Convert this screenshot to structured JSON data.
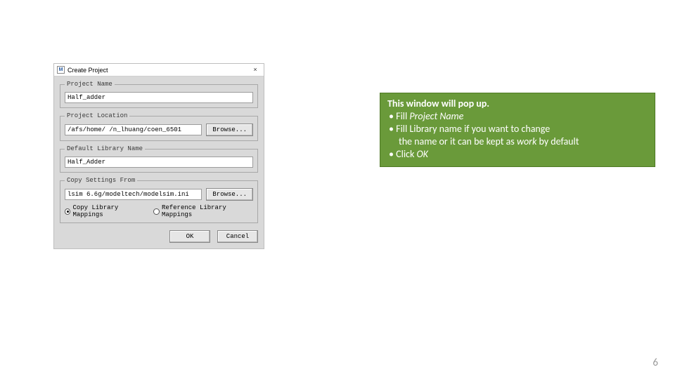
{
  "dialog": {
    "app_icon_letter": "M",
    "title": "Create Project",
    "close_glyph": "×",
    "group_project_name": {
      "legend": "Project Name",
      "value": "Half_adder"
    },
    "group_project_location": {
      "legend": "Project Location",
      "value": "/afs/home/ /n_lhuang/coen_6501",
      "browse_label": "Browse..."
    },
    "group_default_lib": {
      "legend": "Default Library Name",
      "value": "Half_Adder"
    },
    "group_copy_settings": {
      "legend": "Copy Settings From",
      "value": "lsim 6.6g/modeltech/modelsim.ini",
      "browse_label": "Browse...",
      "radio_copy": "Copy Library Mappings",
      "radio_ref": "Reference Library Mappings"
    },
    "ok_label": "OK",
    "cancel_label": "Cancel"
  },
  "callout": {
    "heading": "This window will pop up.",
    "bullet1_prefix": "Fill ",
    "bullet1_em": "Project Name",
    "bullet2": "Fill Library name if you want to change",
    "bullet2_cont_a": "the name or it can be kept as ",
    "bullet2_cont_em": "work",
    "bullet2_cont_b": " by default",
    "bullet3_prefix": "Click ",
    "bullet3_em": "OK"
  },
  "page_number": "6"
}
